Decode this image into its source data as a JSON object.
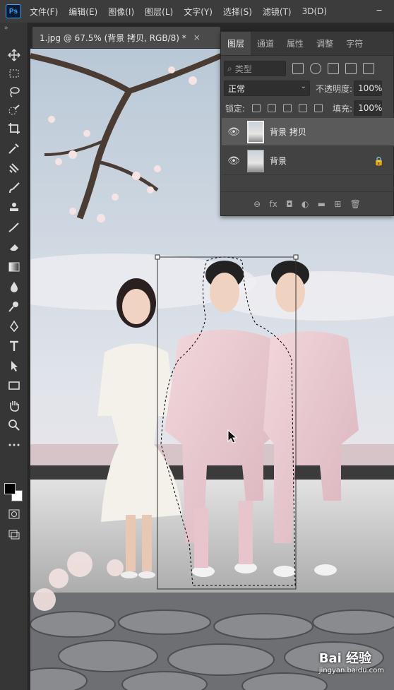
{
  "app": {
    "logo": "Ps"
  },
  "menu": [
    "文件(F)",
    "编辑(E)",
    "图像(I)",
    "图层(L)",
    "文字(Y)",
    "选择(S)",
    "滤镜(T)",
    "3D(D)"
  ],
  "document_tab": {
    "title": "1.jpg @ 67.5% (背景 拷贝, RGB/8) *",
    "close": "×"
  },
  "tools": [
    "move-icon",
    "marquee-icon",
    "lasso-icon",
    "quick-select-icon",
    "crop-icon",
    "eyedropper-icon",
    "healing-icon",
    "brush-icon",
    "stamp-icon",
    "history-brush-icon",
    "eraser-icon",
    "gradient-icon",
    "blur-icon",
    "dodge-icon",
    "pen-icon",
    "type-icon",
    "path-select-icon",
    "rectangle-icon",
    "hand-icon",
    "zoom-icon",
    "more-icon"
  ],
  "colors": {
    "foreground": "#000000",
    "background": "#ffffff",
    "accent": "#31a8ff"
  },
  "layers_panel": {
    "tabs": [
      "图层",
      "通道",
      "属性",
      "调整",
      "字符"
    ],
    "active_tab": "图层",
    "filter_label": "类型",
    "blend_mode": "正常",
    "opacity_label": "不透明度:",
    "opacity_value": "100%",
    "lock_label": "锁定:",
    "fill_label": "填充:",
    "fill_value": "100%",
    "layers": [
      {
        "name": "背景 拷贝",
        "visible": true,
        "selected": true,
        "locked": false
      },
      {
        "name": "背景",
        "visible": true,
        "selected": false,
        "locked": true
      }
    ],
    "footer_icons": [
      "link-icon",
      "fx-icon",
      "mask-icon",
      "adjustment-icon",
      "group-icon",
      "new-layer-icon",
      "trash-icon"
    ],
    "fx_label": "fx"
  },
  "watermark": {
    "brand": "Bai 经验",
    "url": "jingyan.baidu.com"
  }
}
